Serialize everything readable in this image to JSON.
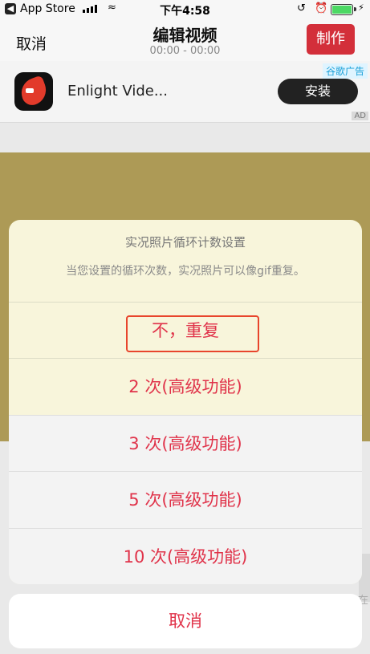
{
  "status": {
    "carrier": "App Store",
    "time": "下午4:58",
    "signal_bars": 4,
    "battery_percent": 100
  },
  "navbar": {
    "cancel": "取消",
    "title": "编辑视频",
    "timecode": "00:00 - 00:00",
    "make": "制作"
  },
  "ad": {
    "tag": "谷歌广告",
    "app_name": "Enlight Vide...",
    "install": "安装",
    "mark": "AD"
  },
  "sheet": {
    "title": "实况照片循环计数设置",
    "message": "当您设置的循环次数，实况照片可以像gif重复。",
    "options": [
      {
        "label": "不，重复",
        "highlighted": true
      },
      {
        "label": "2 次(高级功能)"
      },
      {
        "label": "3 次(高级功能)"
      },
      {
        "label": "5 次(高级功能)"
      },
      {
        "label": "10 次(高级功能)"
      }
    ],
    "cancel": "取消"
  },
  "colors": {
    "accent_red": "#e0334a",
    "make_button": "#d32f3a",
    "highlight_box": "#e8452c",
    "video_bg": "#ad9a56"
  }
}
